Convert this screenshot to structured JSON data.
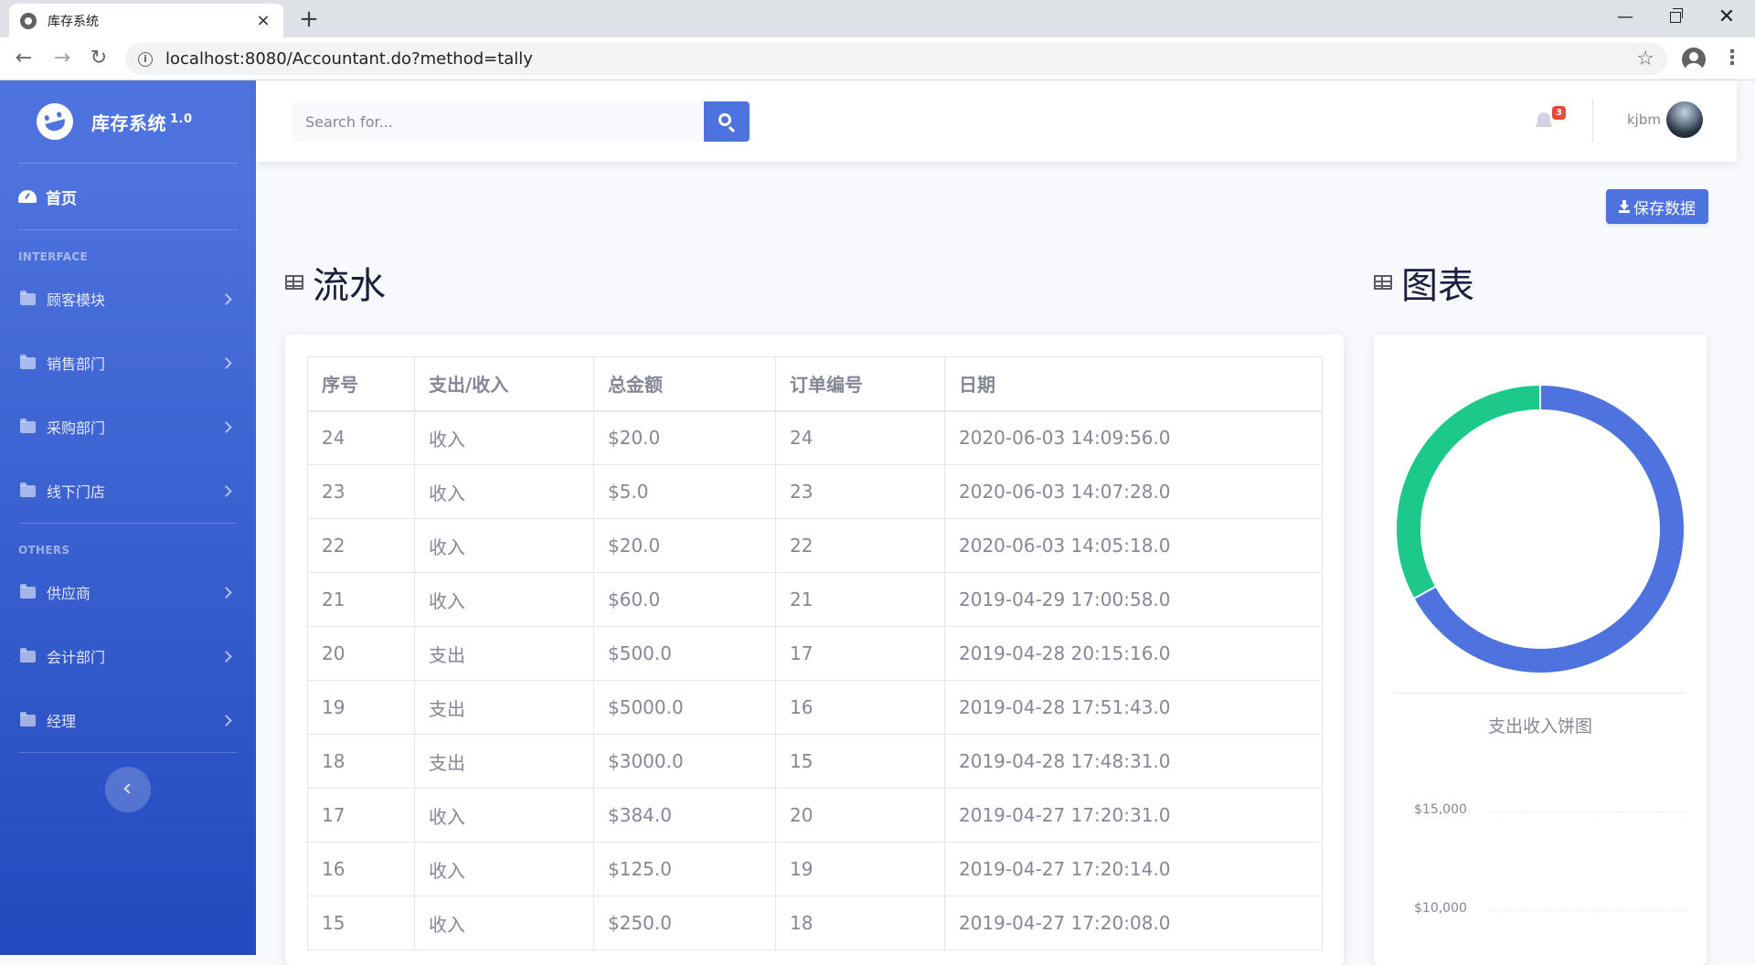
{
  "browser": {
    "tab_title": "库存系统",
    "tab_close": "×",
    "new_tab": "+",
    "url": "localhost:8080/Accountant.do?method=tally",
    "win_min": "—",
    "win_close": "✕",
    "info": "i",
    "menu": "⋮"
  },
  "sidebar": {
    "brand": "库存系统",
    "version": "1.0",
    "home": "首页",
    "heading_interface": "INTERFACE",
    "interface_items": [
      {
        "label": "顾客模块"
      },
      {
        "label": "销售部门"
      },
      {
        "label": "采购部门"
      },
      {
        "label": "线下门店"
      }
    ],
    "heading_others": "OTHERS",
    "other_items": [
      {
        "label": "供应商"
      },
      {
        "label": "会计部门"
      },
      {
        "label": "经理"
      }
    ]
  },
  "topbar": {
    "search_placeholder": "Search for...",
    "notification_count": "3",
    "username": "kjbm"
  },
  "main": {
    "save_button": "保存数据",
    "flow_title": "流水",
    "chart_title": "图表"
  },
  "table": {
    "headers": [
      "序号",
      "支出/收入",
      "总金额",
      "订单编号",
      "日期"
    ],
    "rows": [
      [
        "24",
        "收入",
        "$20.0",
        "24",
        "2020-06-03 14:09:56.0"
      ],
      [
        "23",
        "收入",
        "$5.0",
        "23",
        "2020-06-03 14:07:28.0"
      ],
      [
        "22",
        "收入",
        "$20.0",
        "22",
        "2020-06-03 14:05:18.0"
      ],
      [
        "21",
        "收入",
        "$60.0",
        "21",
        "2019-04-29 17:00:58.0"
      ],
      [
        "20",
        "支出",
        "$500.0",
        "17",
        "2019-04-28 20:15:16.0"
      ],
      [
        "19",
        "支出",
        "$5000.0",
        "16",
        "2019-04-28 17:51:43.0"
      ],
      [
        "18",
        "支出",
        "$3000.0",
        "15",
        "2019-04-28 17:48:31.0"
      ],
      [
        "17",
        "收入",
        "$384.0",
        "20",
        "2019-04-27 17:20:31.0"
      ],
      [
        "16",
        "收入",
        "$125.0",
        "19",
        "2019-04-27 17:20:14.0"
      ],
      [
        "15",
        "收入",
        "$250.0",
        "18",
        "2019-04-27 17:20:08.0"
      ]
    ]
  },
  "chart": {
    "caption": "支出收入饼图",
    "colors": {
      "blue": "#4e73df",
      "green": "#1cc88a"
    },
    "axis_labels": [
      "$15,000",
      "$10,000"
    ]
  },
  "chart_data": {
    "type": "pie",
    "values": [
      0.67,
      0.33
    ],
    "colors": [
      "#4e73df",
      "#1cc88a"
    ],
    "title": "支出收入饼图"
  }
}
